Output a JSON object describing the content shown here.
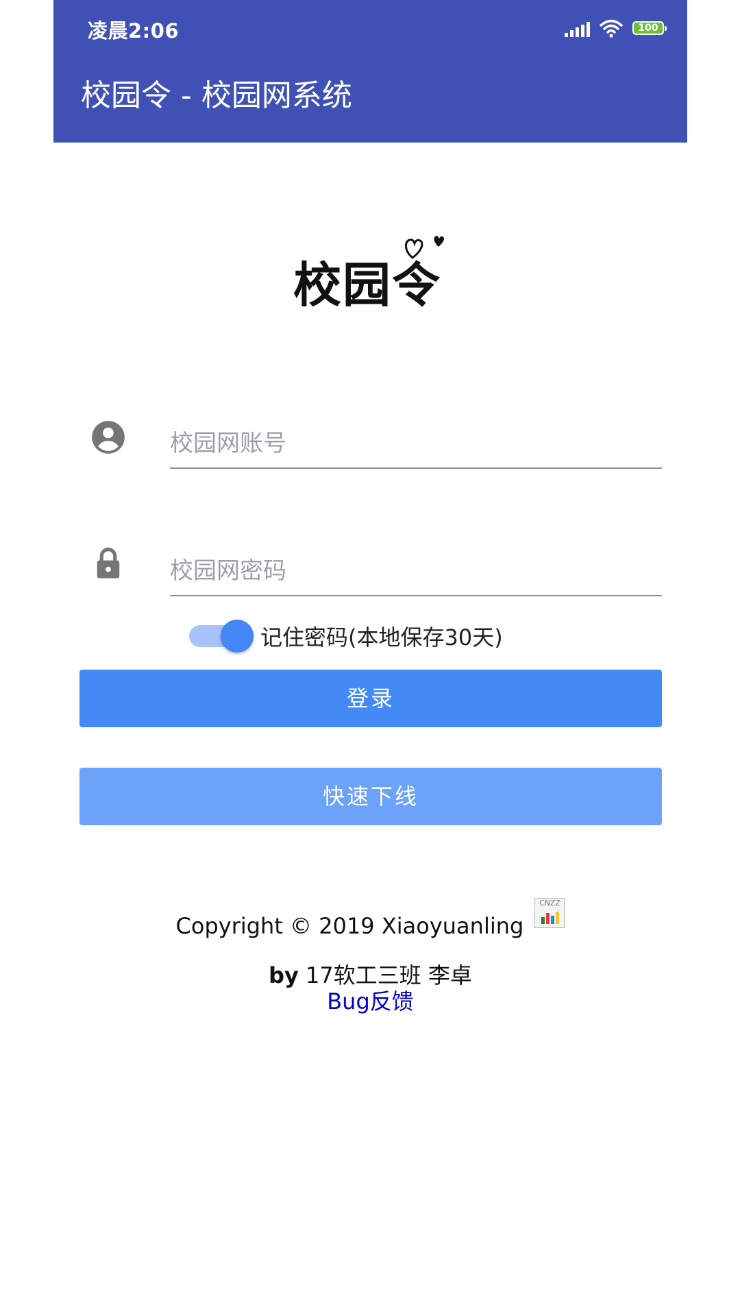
{
  "status_bar": {
    "time": "凌晨2:06",
    "battery": "100",
    "icons": [
      "signal-icon",
      "wifi-icon",
      "battery-icon"
    ]
  },
  "app_bar": {
    "title": "校园令 - 校园网系统"
  },
  "logo": {
    "text": "校园令",
    "icon": "heart-logo"
  },
  "form": {
    "account_placeholder": "校园网账号",
    "account_icon": "account-circle-icon",
    "password_placeholder": "校园网密码",
    "password_icon": "lock-icon",
    "remember_label": "记住密码(本地保存30天)",
    "remember_checked": true
  },
  "buttons": {
    "login": "登录",
    "quick_logout": "快速下线"
  },
  "footer": {
    "copyright": "Copyright © 2019 Xiaoyuanling",
    "stats_icon_label": "CNZZ",
    "author_prefix": "by",
    "author": "17软工三班 李卓",
    "bug_link": "Bug反馈"
  },
  "colors": {
    "app_bar": "#3f51b5",
    "login_button": "#448af7",
    "logout_button": "#6ca3fa",
    "link": "#0000cc"
  }
}
